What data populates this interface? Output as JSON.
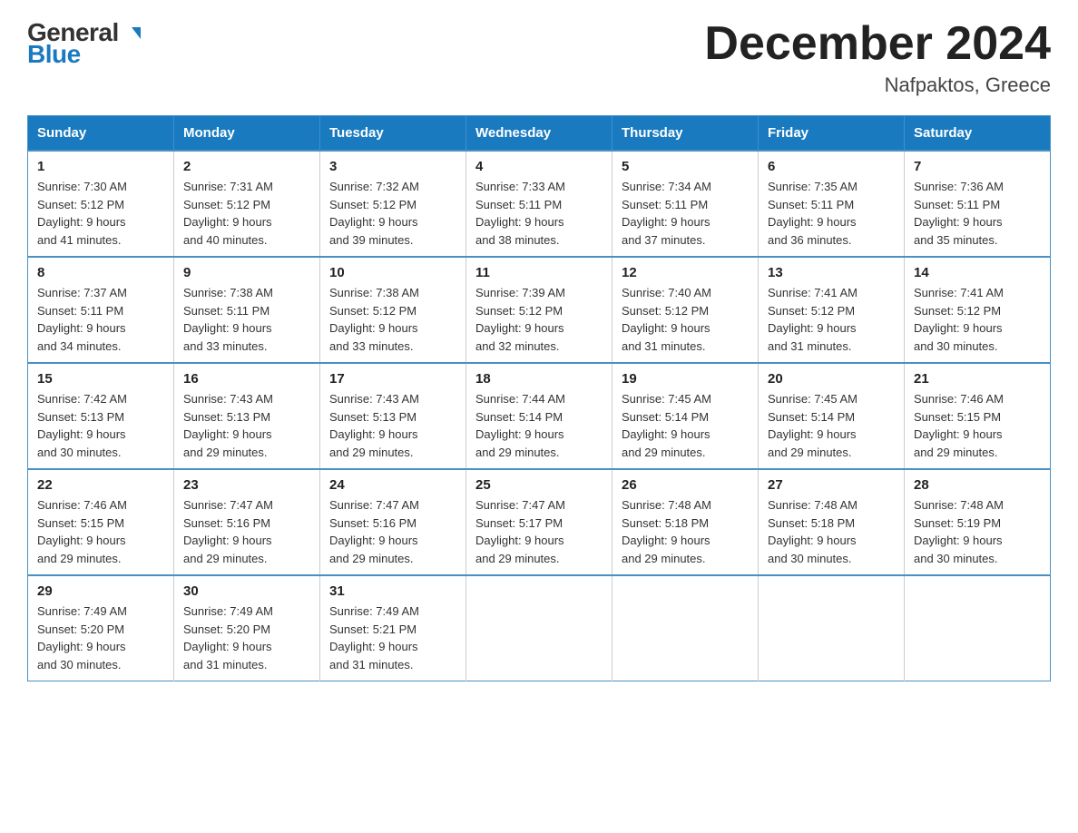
{
  "logo": {
    "general": "General",
    "blue": "Blue"
  },
  "title": {
    "month": "December 2024",
    "location": "Nafpaktos, Greece"
  },
  "weekdays": [
    "Sunday",
    "Monday",
    "Tuesday",
    "Wednesday",
    "Thursday",
    "Friday",
    "Saturday"
  ],
  "weeks": [
    [
      {
        "day": "1",
        "sunrise": "7:30 AM",
        "sunset": "5:12 PM",
        "daylight": "9 hours and 41 minutes."
      },
      {
        "day": "2",
        "sunrise": "7:31 AM",
        "sunset": "5:12 PM",
        "daylight": "9 hours and 40 minutes."
      },
      {
        "day": "3",
        "sunrise": "7:32 AM",
        "sunset": "5:12 PM",
        "daylight": "9 hours and 39 minutes."
      },
      {
        "day": "4",
        "sunrise": "7:33 AM",
        "sunset": "5:11 PM",
        "daylight": "9 hours and 38 minutes."
      },
      {
        "day": "5",
        "sunrise": "7:34 AM",
        "sunset": "5:11 PM",
        "daylight": "9 hours and 37 minutes."
      },
      {
        "day": "6",
        "sunrise": "7:35 AM",
        "sunset": "5:11 PM",
        "daylight": "9 hours and 36 minutes."
      },
      {
        "day": "7",
        "sunrise": "7:36 AM",
        "sunset": "5:11 PM",
        "daylight": "9 hours and 35 minutes."
      }
    ],
    [
      {
        "day": "8",
        "sunrise": "7:37 AM",
        "sunset": "5:11 PM",
        "daylight": "9 hours and 34 minutes."
      },
      {
        "day": "9",
        "sunrise": "7:38 AM",
        "sunset": "5:11 PM",
        "daylight": "9 hours and 33 minutes."
      },
      {
        "day": "10",
        "sunrise": "7:38 AM",
        "sunset": "5:12 PM",
        "daylight": "9 hours and 33 minutes."
      },
      {
        "day": "11",
        "sunrise": "7:39 AM",
        "sunset": "5:12 PM",
        "daylight": "9 hours and 32 minutes."
      },
      {
        "day": "12",
        "sunrise": "7:40 AM",
        "sunset": "5:12 PM",
        "daylight": "9 hours and 31 minutes."
      },
      {
        "day": "13",
        "sunrise": "7:41 AM",
        "sunset": "5:12 PM",
        "daylight": "9 hours and 31 minutes."
      },
      {
        "day": "14",
        "sunrise": "7:41 AM",
        "sunset": "5:12 PM",
        "daylight": "9 hours and 30 minutes."
      }
    ],
    [
      {
        "day": "15",
        "sunrise": "7:42 AM",
        "sunset": "5:13 PM",
        "daylight": "9 hours and 30 minutes."
      },
      {
        "day": "16",
        "sunrise": "7:43 AM",
        "sunset": "5:13 PM",
        "daylight": "9 hours and 29 minutes."
      },
      {
        "day": "17",
        "sunrise": "7:43 AM",
        "sunset": "5:13 PM",
        "daylight": "9 hours and 29 minutes."
      },
      {
        "day": "18",
        "sunrise": "7:44 AM",
        "sunset": "5:14 PM",
        "daylight": "9 hours and 29 minutes."
      },
      {
        "day": "19",
        "sunrise": "7:45 AM",
        "sunset": "5:14 PM",
        "daylight": "9 hours and 29 minutes."
      },
      {
        "day": "20",
        "sunrise": "7:45 AM",
        "sunset": "5:14 PM",
        "daylight": "9 hours and 29 minutes."
      },
      {
        "day": "21",
        "sunrise": "7:46 AM",
        "sunset": "5:15 PM",
        "daylight": "9 hours and 29 minutes."
      }
    ],
    [
      {
        "day": "22",
        "sunrise": "7:46 AM",
        "sunset": "5:15 PM",
        "daylight": "9 hours and 29 minutes."
      },
      {
        "day": "23",
        "sunrise": "7:47 AM",
        "sunset": "5:16 PM",
        "daylight": "9 hours and 29 minutes."
      },
      {
        "day": "24",
        "sunrise": "7:47 AM",
        "sunset": "5:16 PM",
        "daylight": "9 hours and 29 minutes."
      },
      {
        "day": "25",
        "sunrise": "7:47 AM",
        "sunset": "5:17 PM",
        "daylight": "9 hours and 29 minutes."
      },
      {
        "day": "26",
        "sunrise": "7:48 AM",
        "sunset": "5:18 PM",
        "daylight": "9 hours and 29 minutes."
      },
      {
        "day": "27",
        "sunrise": "7:48 AM",
        "sunset": "5:18 PM",
        "daylight": "9 hours and 30 minutes."
      },
      {
        "day": "28",
        "sunrise": "7:48 AM",
        "sunset": "5:19 PM",
        "daylight": "9 hours and 30 minutes."
      }
    ],
    [
      {
        "day": "29",
        "sunrise": "7:49 AM",
        "sunset": "5:20 PM",
        "daylight": "9 hours and 30 minutes."
      },
      {
        "day": "30",
        "sunrise": "7:49 AM",
        "sunset": "5:20 PM",
        "daylight": "9 hours and 31 minutes."
      },
      {
        "day": "31",
        "sunrise": "7:49 AM",
        "sunset": "5:21 PM",
        "daylight": "9 hours and 31 minutes."
      },
      null,
      null,
      null,
      null
    ]
  ],
  "labels": {
    "sunrise": "Sunrise:",
    "sunset": "Sunset:",
    "daylight": "Daylight:"
  }
}
